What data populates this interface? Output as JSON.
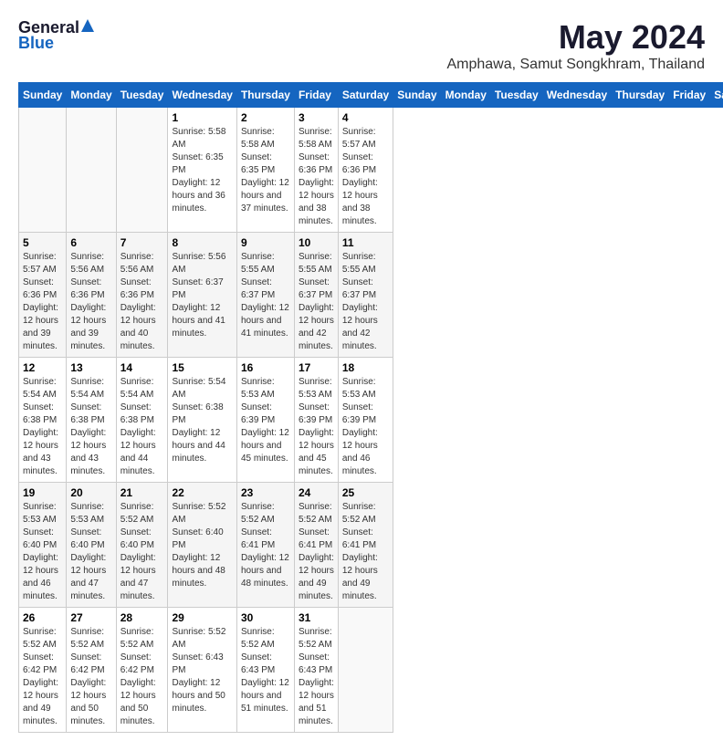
{
  "logo": {
    "general": "General",
    "blue": "Blue"
  },
  "title": "May 2024",
  "subtitle": "Amphawa, Samut Songkhram, Thailand",
  "days_of_week": [
    "Sunday",
    "Monday",
    "Tuesday",
    "Wednesday",
    "Thursday",
    "Friday",
    "Saturday"
  ],
  "weeks": [
    [
      {
        "num": "",
        "sunrise": "",
        "sunset": "",
        "daylight": ""
      },
      {
        "num": "",
        "sunrise": "",
        "sunset": "",
        "daylight": ""
      },
      {
        "num": "",
        "sunrise": "",
        "sunset": "",
        "daylight": ""
      },
      {
        "num": "1",
        "sunrise": "Sunrise: 5:58 AM",
        "sunset": "Sunset: 6:35 PM",
        "daylight": "Daylight: 12 hours and 36 minutes."
      },
      {
        "num": "2",
        "sunrise": "Sunrise: 5:58 AM",
        "sunset": "Sunset: 6:35 PM",
        "daylight": "Daylight: 12 hours and 37 minutes."
      },
      {
        "num": "3",
        "sunrise": "Sunrise: 5:58 AM",
        "sunset": "Sunset: 6:36 PM",
        "daylight": "Daylight: 12 hours and 38 minutes."
      },
      {
        "num": "4",
        "sunrise": "Sunrise: 5:57 AM",
        "sunset": "Sunset: 6:36 PM",
        "daylight": "Daylight: 12 hours and 38 minutes."
      }
    ],
    [
      {
        "num": "5",
        "sunrise": "Sunrise: 5:57 AM",
        "sunset": "Sunset: 6:36 PM",
        "daylight": "Daylight: 12 hours and 39 minutes."
      },
      {
        "num": "6",
        "sunrise": "Sunrise: 5:56 AM",
        "sunset": "Sunset: 6:36 PM",
        "daylight": "Daylight: 12 hours and 39 minutes."
      },
      {
        "num": "7",
        "sunrise": "Sunrise: 5:56 AM",
        "sunset": "Sunset: 6:36 PM",
        "daylight": "Daylight: 12 hours and 40 minutes."
      },
      {
        "num": "8",
        "sunrise": "Sunrise: 5:56 AM",
        "sunset": "Sunset: 6:37 PM",
        "daylight": "Daylight: 12 hours and 41 minutes."
      },
      {
        "num": "9",
        "sunrise": "Sunrise: 5:55 AM",
        "sunset": "Sunset: 6:37 PM",
        "daylight": "Daylight: 12 hours and 41 minutes."
      },
      {
        "num": "10",
        "sunrise": "Sunrise: 5:55 AM",
        "sunset": "Sunset: 6:37 PM",
        "daylight": "Daylight: 12 hours and 42 minutes."
      },
      {
        "num": "11",
        "sunrise": "Sunrise: 5:55 AM",
        "sunset": "Sunset: 6:37 PM",
        "daylight": "Daylight: 12 hours and 42 minutes."
      }
    ],
    [
      {
        "num": "12",
        "sunrise": "Sunrise: 5:54 AM",
        "sunset": "Sunset: 6:38 PM",
        "daylight": "Daylight: 12 hours and 43 minutes."
      },
      {
        "num": "13",
        "sunrise": "Sunrise: 5:54 AM",
        "sunset": "Sunset: 6:38 PM",
        "daylight": "Daylight: 12 hours and 43 minutes."
      },
      {
        "num": "14",
        "sunrise": "Sunrise: 5:54 AM",
        "sunset": "Sunset: 6:38 PM",
        "daylight": "Daylight: 12 hours and 44 minutes."
      },
      {
        "num": "15",
        "sunrise": "Sunrise: 5:54 AM",
        "sunset": "Sunset: 6:38 PM",
        "daylight": "Daylight: 12 hours and 44 minutes."
      },
      {
        "num": "16",
        "sunrise": "Sunrise: 5:53 AM",
        "sunset": "Sunset: 6:39 PM",
        "daylight": "Daylight: 12 hours and 45 minutes."
      },
      {
        "num": "17",
        "sunrise": "Sunrise: 5:53 AM",
        "sunset": "Sunset: 6:39 PM",
        "daylight": "Daylight: 12 hours and 45 minutes."
      },
      {
        "num": "18",
        "sunrise": "Sunrise: 5:53 AM",
        "sunset": "Sunset: 6:39 PM",
        "daylight": "Daylight: 12 hours and 46 minutes."
      }
    ],
    [
      {
        "num": "19",
        "sunrise": "Sunrise: 5:53 AM",
        "sunset": "Sunset: 6:40 PM",
        "daylight": "Daylight: 12 hours and 46 minutes."
      },
      {
        "num": "20",
        "sunrise": "Sunrise: 5:53 AM",
        "sunset": "Sunset: 6:40 PM",
        "daylight": "Daylight: 12 hours and 47 minutes."
      },
      {
        "num": "21",
        "sunrise": "Sunrise: 5:52 AM",
        "sunset": "Sunset: 6:40 PM",
        "daylight": "Daylight: 12 hours and 47 minutes."
      },
      {
        "num": "22",
        "sunrise": "Sunrise: 5:52 AM",
        "sunset": "Sunset: 6:40 PM",
        "daylight": "Daylight: 12 hours and 48 minutes."
      },
      {
        "num": "23",
        "sunrise": "Sunrise: 5:52 AM",
        "sunset": "Sunset: 6:41 PM",
        "daylight": "Daylight: 12 hours and 48 minutes."
      },
      {
        "num": "24",
        "sunrise": "Sunrise: 5:52 AM",
        "sunset": "Sunset: 6:41 PM",
        "daylight": "Daylight: 12 hours and 49 minutes."
      },
      {
        "num": "25",
        "sunrise": "Sunrise: 5:52 AM",
        "sunset": "Sunset: 6:41 PM",
        "daylight": "Daylight: 12 hours and 49 minutes."
      }
    ],
    [
      {
        "num": "26",
        "sunrise": "Sunrise: 5:52 AM",
        "sunset": "Sunset: 6:42 PM",
        "daylight": "Daylight: 12 hours and 49 minutes."
      },
      {
        "num": "27",
        "sunrise": "Sunrise: 5:52 AM",
        "sunset": "Sunset: 6:42 PM",
        "daylight": "Daylight: 12 hours and 50 minutes."
      },
      {
        "num": "28",
        "sunrise": "Sunrise: 5:52 AM",
        "sunset": "Sunset: 6:42 PM",
        "daylight": "Daylight: 12 hours and 50 minutes."
      },
      {
        "num": "29",
        "sunrise": "Sunrise: 5:52 AM",
        "sunset": "Sunset: 6:43 PM",
        "daylight": "Daylight: 12 hours and 50 minutes."
      },
      {
        "num": "30",
        "sunrise": "Sunrise: 5:52 AM",
        "sunset": "Sunset: 6:43 PM",
        "daylight": "Daylight: 12 hours and 51 minutes."
      },
      {
        "num": "31",
        "sunrise": "Sunrise: 5:52 AM",
        "sunset": "Sunset: 6:43 PM",
        "daylight": "Daylight: 12 hours and 51 minutes."
      },
      {
        "num": "",
        "sunrise": "",
        "sunset": "",
        "daylight": ""
      }
    ]
  ]
}
